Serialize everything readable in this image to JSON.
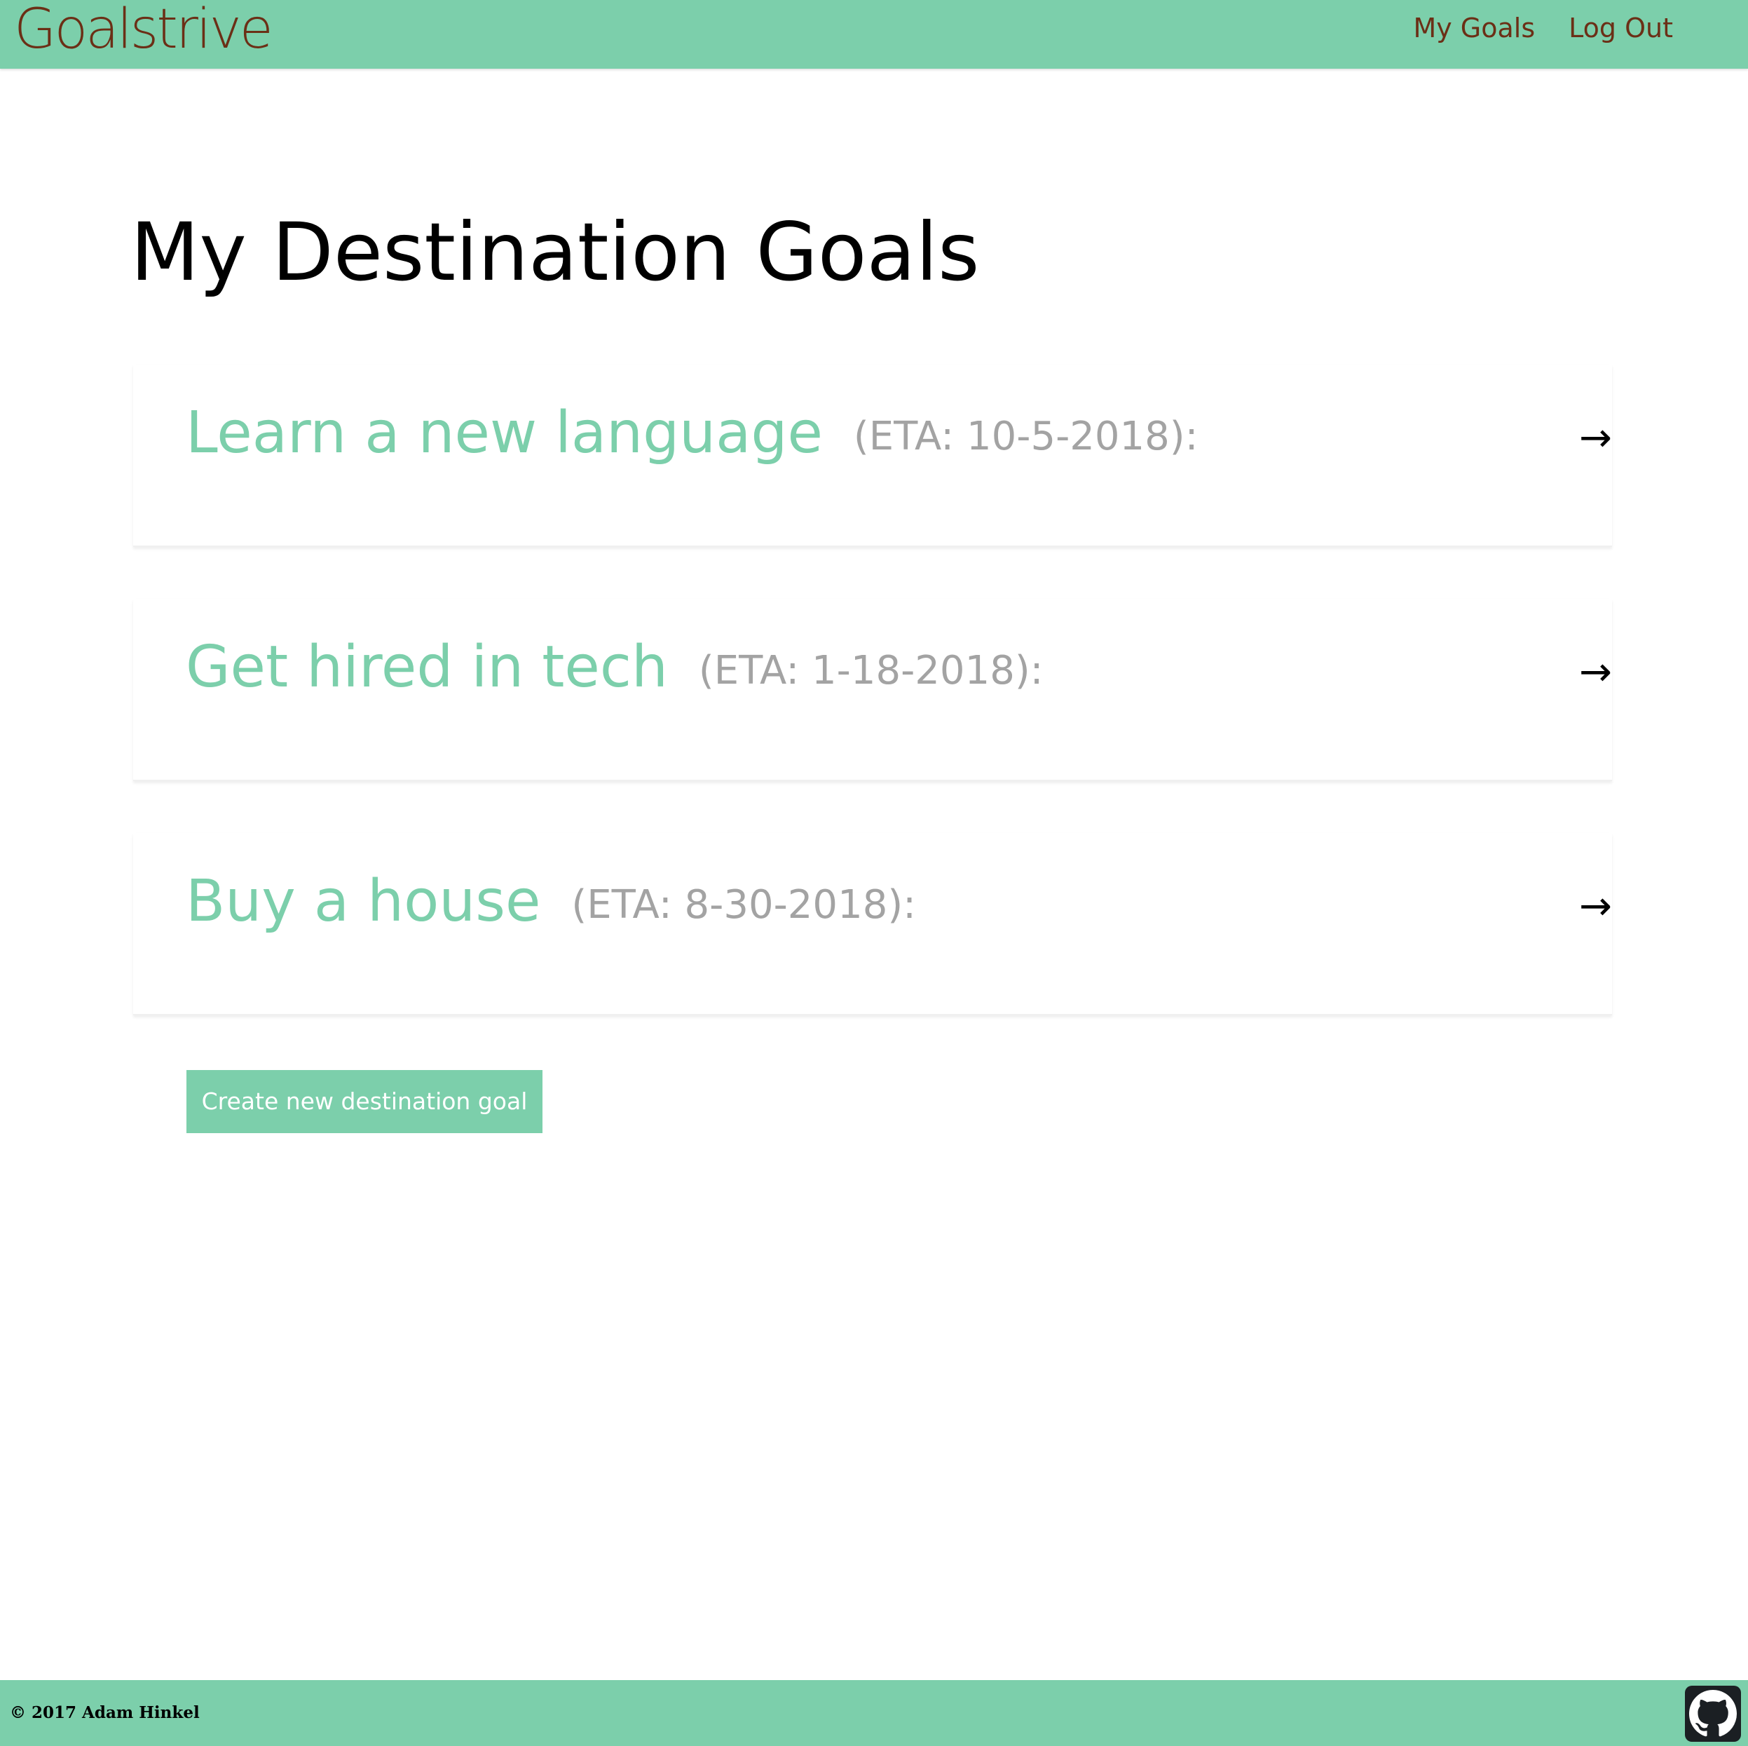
{
  "navbar": {
    "brand": "Goalstrive",
    "links": [
      {
        "label": "My Goals"
      },
      {
        "label": "Log Out"
      }
    ]
  },
  "main": {
    "title": "My Destination Goals",
    "goals": [
      {
        "title": "Learn a new language",
        "eta": "(ETA: 10-5-2018):",
        "arrow": "→"
      },
      {
        "title": "Get hired in tech",
        "eta": "(ETA: 1-18-2018):",
        "arrow": "→"
      },
      {
        "title": "Buy a house",
        "eta": "(ETA: 8-30-2018):",
        "arrow": "→"
      }
    ],
    "create_button_label": "Create new destination goal"
  },
  "footer": {
    "copyright": "© 2017 Adam Hinkel",
    "github_icon": "github-icon"
  },
  "colors": {
    "accent": "#7ccfab",
    "brand_text": "#6b2f16",
    "eta_text": "#a3a3a3"
  }
}
